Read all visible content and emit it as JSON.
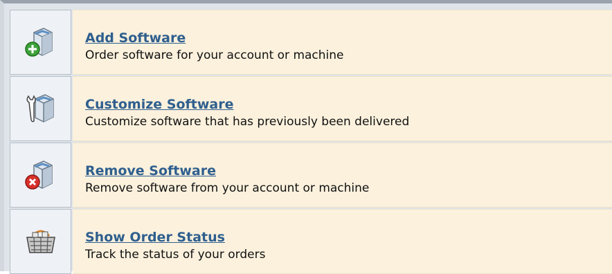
{
  "menu": {
    "items": [
      {
        "icon": "add-software-icon",
        "title": "Add Software",
        "description": "Order software for your account or machine"
      },
      {
        "icon": "customize-software-icon",
        "title": "Customize Software",
        "description": "Customize software that has previously been delivered"
      },
      {
        "icon": "remove-software-icon",
        "title": "Remove Software",
        "description": "Remove software from your account or machine"
      },
      {
        "icon": "order-status-icon",
        "title": "Show Order Status",
        "description": "Track the status of your orders"
      }
    ]
  },
  "colors": {
    "row_background": "#fbf1dd",
    "icon_background": "#eef1f5",
    "link": "#2f5f8e",
    "add_badge": "#3da33a",
    "remove_badge": "#d8312a"
  }
}
